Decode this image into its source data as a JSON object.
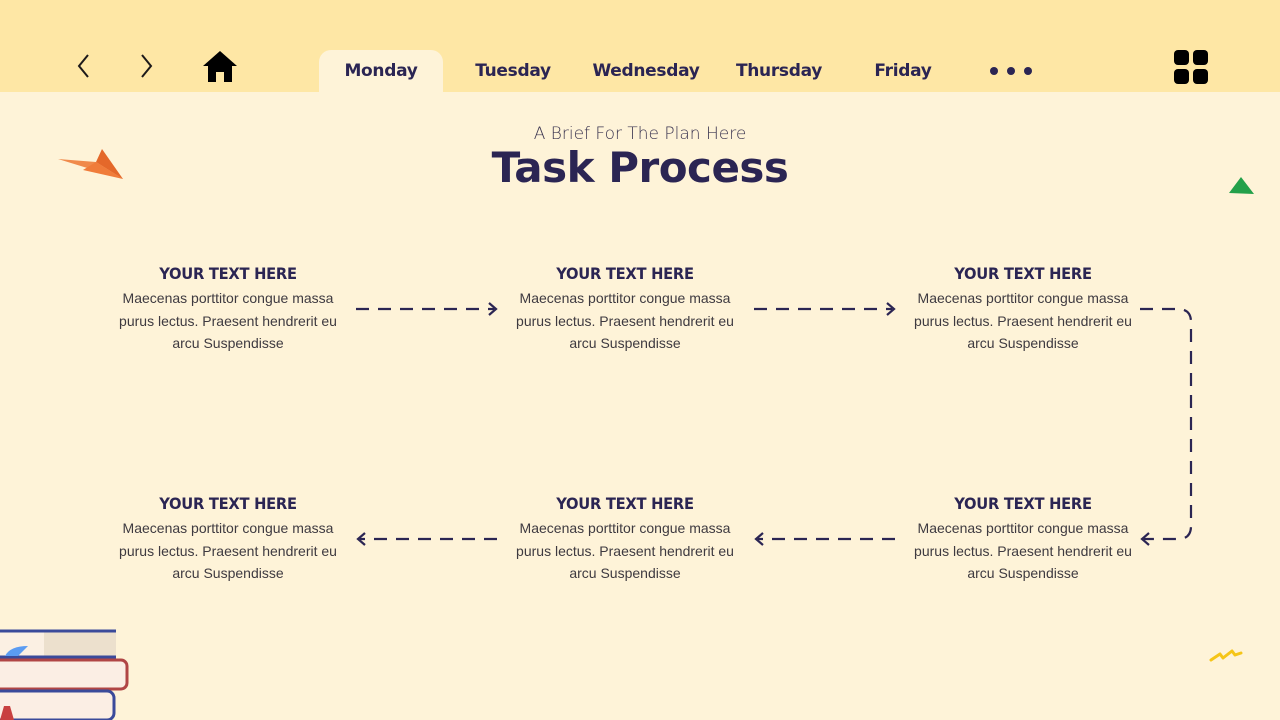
{
  "nav": {
    "back_icon": "chevron-left-icon",
    "forward_icon": "chevron-right-icon",
    "home_icon": "home-icon",
    "tabs": [
      {
        "label": "Monday",
        "active": true
      },
      {
        "label": "Tuesday",
        "active": false
      },
      {
        "label": "Wednesday",
        "active": false
      },
      {
        "label": "Thursday",
        "active": false
      },
      {
        "label": "Friday",
        "active": false
      }
    ],
    "more_icon": "more-dots-icon",
    "menu_icon": "grid-menu-icon"
  },
  "header": {
    "subtitle": "A Brief For The Plan Here",
    "title": "Task Process"
  },
  "steps": [
    {
      "heading": "YOUR TEXT HERE",
      "body": "Maecenas porttitor  congue massa purus lectus. Praesent hendrerit  eu arcu Suspendisse"
    },
    {
      "heading": "YOUR TEXT HERE",
      "body": "Maecenas porttitor  congue massa purus lectus. Praesent hendrerit  eu arcu Suspendisse"
    },
    {
      "heading": "YOUR TEXT HERE",
      "body": "Maecenas porttitor  congue massa purus lectus. Praesent hendrerit  eu arcu Suspendisse"
    },
    {
      "heading": "YOUR TEXT HERE",
      "body": "Maecenas porttitor  congue massa purus lectus. Praesent hendrerit  eu arcu Suspendisse"
    },
    {
      "heading": "YOUR TEXT HERE",
      "body": "Maecenas porttitor  congue massa purus lectus. Praesent hendrerit  eu arcu Suspendisse"
    },
    {
      "heading": "YOUR TEXT HERE",
      "body": "Maecenas porttitor  congue massa purus lectus. Praesent hendrerit  eu arcu Suspendisse"
    }
  ],
  "colors": {
    "topbar": "#fee7a5",
    "background": "#fef3d8",
    "primary_text": "#2b2553",
    "accent_orange": "#f07c3a",
    "accent_green": "#23a04a",
    "accent_yellow": "#f5c518"
  }
}
